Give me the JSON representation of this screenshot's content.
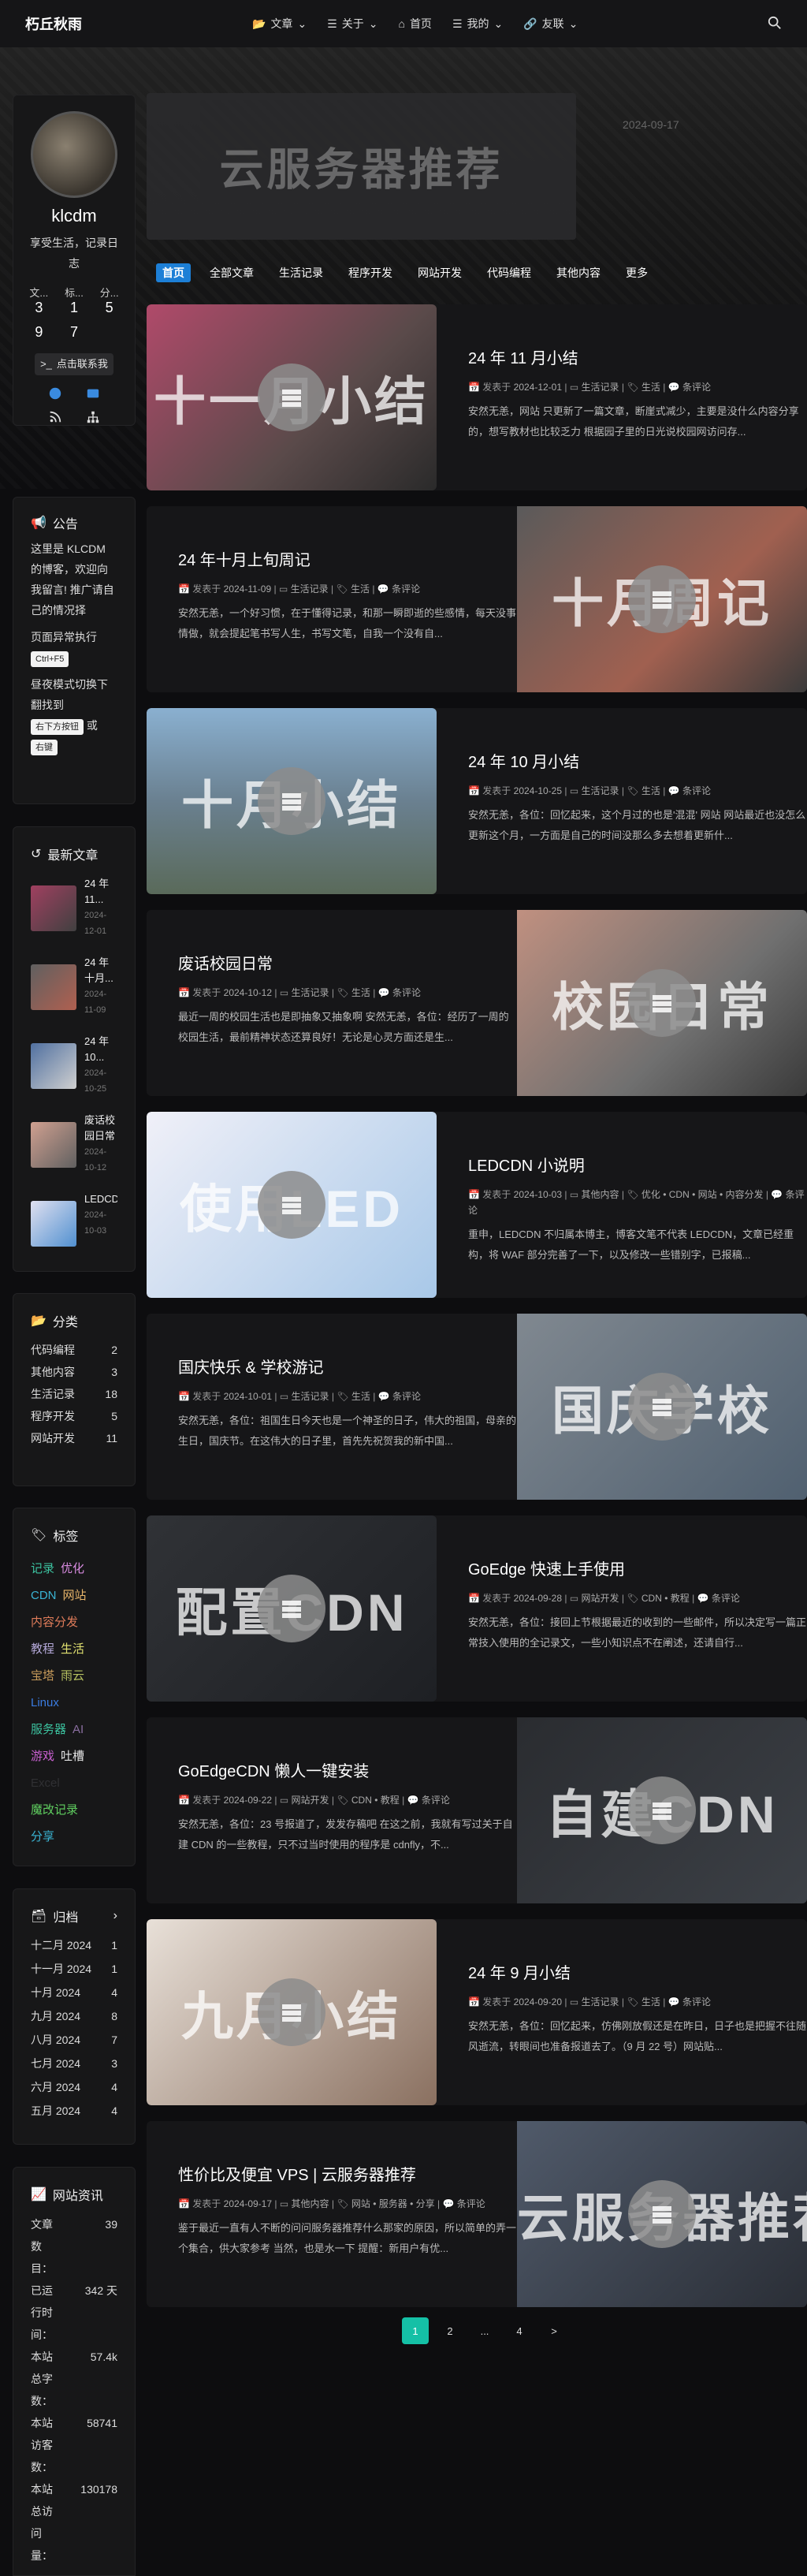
{
  "nav": {
    "brand": "朽丘秋雨",
    "items": [
      {
        "label": "文章",
        "icon": "folder-icon",
        "dropdown": true
      },
      {
        "label": "关于",
        "icon": "list-icon",
        "dropdown": true
      },
      {
        "label": "首页",
        "icon": "home-icon",
        "dropdown": false
      },
      {
        "label": "我的",
        "icon": "list-icon",
        "dropdown": true
      },
      {
        "label": "友联",
        "icon": "link-icon",
        "dropdown": true
      }
    ]
  },
  "profile": {
    "name": "klcdm",
    "desc": "享受生活，记录日志",
    "stats": [
      {
        "label": "文...",
        "value": "3"
      },
      {
        "label": "标...",
        "value": "1"
      },
      {
        "label": "分...",
        "value": "5"
      },
      {
        "label": "",
        "value": "9"
      },
      {
        "label": "",
        "value": "7"
      },
      {
        "label": "",
        "value": ""
      }
    ],
    "terminal_button": "点击联系我"
  },
  "notice": {
    "title": "公告",
    "p1": "这里是 KLCDM 的博客，欢迎向我留言! 推广请自己的情况择",
    "p2": "页面异常执行",
    "key1": "Ctrl+F5",
    "p3": "昼夜模式切换下翻找到",
    "key2": "右下方按钮",
    "p3b": "或",
    "key3": "右键"
  },
  "recent": {
    "title": "最新文章",
    "items": [
      {
        "title": "24 年 11...",
        "date": "2024-12-01"
      },
      {
        "title": "24 年十月...",
        "date": "2024-11-09"
      },
      {
        "title": "24 年 10...",
        "date": "2024-10-25"
      },
      {
        "title": "废话校园日常",
        "date": "2024-10-12"
      },
      {
        "title": "LEDCDN...",
        "date": "2024-10-03"
      }
    ]
  },
  "categories": {
    "title": "分类",
    "items": [
      {
        "name": "代码编程",
        "count": "2"
      },
      {
        "name": "其他内容",
        "count": "3"
      },
      {
        "name": "生活记录",
        "count": "18"
      },
      {
        "name": "程序开发",
        "count": "5"
      },
      {
        "name": "网站开发",
        "count": "11"
      }
    ]
  },
  "tags": {
    "title": "标签",
    "items": [
      {
        "name": "记录",
        "color": "#3cc3a0"
      },
      {
        "name": "优化",
        "color": "#d88be0"
      },
      {
        "name": "CDN",
        "color": "#3ab5d5"
      },
      {
        "name": "网站",
        "color": "#e8b56a"
      },
      {
        "name": "内容分发",
        "color": "#e07c5a"
      },
      {
        "name": "教程",
        "color": "#b4a8d8"
      },
      {
        "name": "生活",
        "color": "#e0e070"
      },
      {
        "name": "宝塔",
        "color": "#c69a5a"
      },
      {
        "name": "雨云",
        "color": "#b5c060"
      },
      {
        "name": "Linux",
        "color": "#3a7be0"
      },
      {
        "name": "服务器",
        "color": "#3cc3a0"
      },
      {
        "name": "AI",
        "color": "#8a6ea0"
      },
      {
        "name": "游戏",
        "color": "#c860d0"
      },
      {
        "name": "吐槽",
        "color": "#e6e6e6"
      },
      {
        "name": "Excel",
        "color": "#303033"
      },
      {
        "name": "魔改记录",
        "color": "#60d060"
      },
      {
        "name": "分享",
        "color": "#3ab5d5"
      }
    ]
  },
  "archive": {
    "title": "归档",
    "items": [
      {
        "name": "十二月 2024",
        "count": "1"
      },
      {
        "name": "十一月 2024",
        "count": "1"
      },
      {
        "name": "十月 2024",
        "count": "4"
      },
      {
        "name": "九月 2024",
        "count": "8"
      },
      {
        "name": "八月 2024",
        "count": "7"
      },
      {
        "name": "七月 2024",
        "count": "3"
      },
      {
        "name": "六月 2024",
        "count": "4"
      },
      {
        "name": "五月 2024",
        "count": "4"
      }
    ]
  },
  "site_info": {
    "title": "网站资讯",
    "rows": [
      {
        "k": "文章数目：",
        "v": "39"
      },
      {
        "k": "已运行时间：",
        "v": "342 天"
      },
      {
        "k": "本站总字数：",
        "v": "57.4k"
      },
      {
        "k": "本站访客数：",
        "v": "58741"
      },
      {
        "k": "本站总访问量：",
        "v": "130178"
      }
    ]
  },
  "featured": {
    "title": "云服务器推荐",
    "date": "2024-09-17"
  },
  "tabs": [
    "首页",
    "全部文章",
    "生活记录",
    "程序开发",
    "网站开发",
    "代码编程",
    "其他内容",
    "更多"
  ],
  "posts": [
    {
      "title": "24 年 11 月小结",
      "img_text": "十一月小结",
      "date": "2024-12-01",
      "cat": "生活记录",
      "tags": "生活",
      "comments": "条评论",
      "excerpt": "安然无恙，网站 只更新了一篇文章，断崖式减少，主要是没什么内容分享的，想写教材也比较乏力 根据园子里的日光说校园网访问存...",
      "pre": "发表于"
    },
    {
      "title": "24 年十月上旬周记",
      "img_text": "十月周记",
      "date": "2024-11-09",
      "cat": "生活记录",
      "tags": "生活",
      "comments": "条评论",
      "excerpt": "安然无恙，一个好习惯，在于懂得记录，和那一瞬即逝的些感情，每天没事情做，就会提起笔书写人生，书写文笔，自我一个没有自...",
      "pre": "发表于"
    },
    {
      "title": "24 年 10 月小结",
      "img_text": "十月小结",
      "date": "2024-10-25",
      "cat": "生活记录",
      "tags": "生活",
      "comments": "条评论",
      "excerpt": "安然无恙，各位：回忆起来，这个月过的也是'混混' 网站 网站最近也没怎么更新这个月，一方面是自己的时间没那么多去想着更新什...",
      "pre": "发表于"
    },
    {
      "title": "废话校园日常",
      "img_text": "校园日常",
      "date": "2024-10-12",
      "cat": "生活记录",
      "tags": "生活",
      "comments": "条评论",
      "excerpt": "最近一周的校园生活也是即抽象又抽象啊 安然无恙，各位：经历了一周的校园生活，最前精神状态还算良好！无论是心灵方面还是生...",
      "pre": "发表于"
    },
    {
      "title": "LEDCDN 小说明",
      "img_text": "使用LED",
      "date": "2024-10-03",
      "cat": "其他内容",
      "tags": "优化 • CDN • 网站 • 内容分发",
      "comments": "条评论",
      "excerpt": "重申，LEDCDN 不归属本博主，博客文笔不代表 LEDCDN，文章已经重构，将 WAF 部分完善了一下，以及修改一些错别字，已报稿...",
      "pre": "发表于"
    },
    {
      "title": "国庆快乐 & 学校游记",
      "img_text": "国庆学校",
      "date": "2024-10-01",
      "cat": "生活记录",
      "tags": "生活",
      "comments": "条评论",
      "excerpt": "安然无恙，各位：祖国生日今天也是一个神圣的日子，伟大的祖国，母亲的生日，国庆节。在这伟大的日子里，首先先祝贺我的新中国...",
      "pre": "发表于"
    },
    {
      "title": "GoEdge 快速上手使用",
      "img_text": "配置CDN",
      "date": "2024-09-28",
      "cat": "网站开发",
      "tags": "CDN • 教程",
      "comments": "条评论",
      "excerpt": "安然无恙，各位：接回上节根据最近的收到的一些邮件，所以决定写一篇正常技入使用的全记录文，一些小知识点不在阐述，还请自行...",
      "pre": "发表于"
    },
    {
      "title": "GoEdgeCDN 懒人一键安装",
      "img_text": "自建CDN",
      "date": "2024-09-22",
      "cat": "网站开发",
      "tags": "CDN • 教程",
      "comments": "条评论",
      "excerpt": "安然无恙，各位：23 号报道了，发发存稿吧 在这之前，我就有写过关于自建 CDN 的一些教程，只不过当时使用的程序是 cdnfly，不...",
      "pre": "发表于"
    },
    {
      "title": "24 年 9 月小结",
      "img_text": "九月小结",
      "date": "2024-09-20",
      "cat": "生活记录",
      "tags": "生活",
      "comments": "条评论",
      "excerpt": "安然无恙，各位：回忆起来，仿佛刚放假还是在昨日，日子也是把握不往随风逝流，转眼间也准备报道去了。（9 月 22 号）网站贴...",
      "pre": "发表于"
    },
    {
      "title": "性价比及便宜 VPS | 云服务器推荐",
      "img_text": "云服务器推荐",
      "date": "2024-09-17",
      "cat": "其他内容",
      "tags": "网站 • 服务器 • 分享",
      "comments": "条评论",
      "excerpt": "鉴于最近一直有人不断的问问服务器推荐什么那家的原因，所以简单的弄一个集合，供大家参考 当然，也是水一下 提醒：新用户有优...",
      "pre": "发表于"
    }
  ],
  "pagination": [
    "1",
    "2",
    "...",
    "4",
    ">"
  ]
}
